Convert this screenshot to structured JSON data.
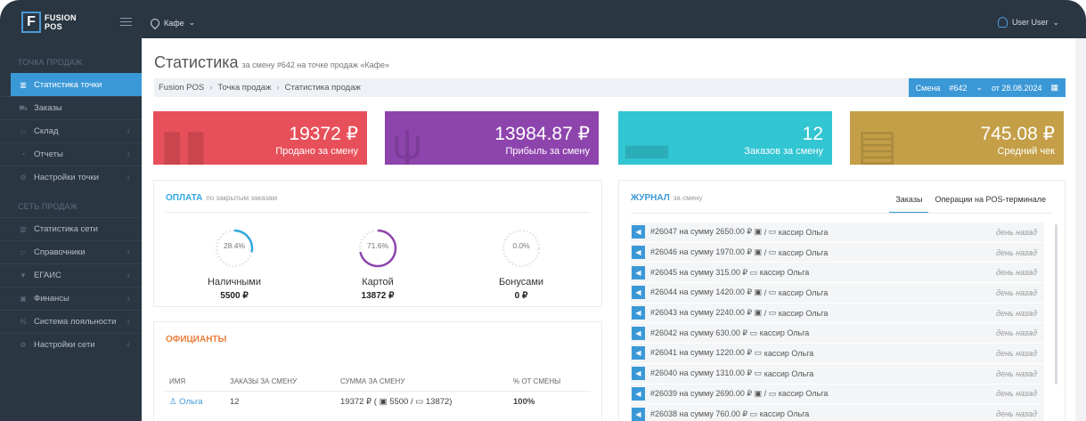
{
  "app": {
    "logo_letter": "F",
    "logo_line1": "FUSION",
    "logo_line2": "POS",
    "location": "Кафе",
    "user": "User User"
  },
  "sidebar": {
    "section1": "ТОЧКА ПРОДАЖ",
    "section2": "СЕТЬ ПРОДАЖ",
    "items1": [
      {
        "label": "Статистика точки",
        "icon": "chart-icon",
        "arrow": ""
      },
      {
        "label": "Заказы",
        "icon": "cart-icon",
        "arrow": ""
      },
      {
        "label": "Склад",
        "icon": "box-icon",
        "arrow": "‹"
      },
      {
        "label": "Отчеты",
        "icon": "pie-icon",
        "arrow": "‹"
      },
      {
        "label": "Настройки точки",
        "icon": "gear-icon",
        "arrow": "‹"
      }
    ],
    "items2": [
      {
        "label": "Статистика сети",
        "icon": "chart-icon",
        "arrow": ""
      },
      {
        "label": "Справочники",
        "icon": "folder-icon",
        "arrow": "‹"
      },
      {
        "label": "ЕГАИС",
        "icon": "filter-icon",
        "arrow": "‹"
      },
      {
        "label": "Финансы",
        "icon": "wallet-icon",
        "arrow": "‹"
      },
      {
        "label": "Система лояльности",
        "icon": "percent-icon",
        "arrow": "‹"
      },
      {
        "label": "Настройки сети",
        "icon": "gear-icon",
        "arrow": "‹"
      }
    ]
  },
  "page": {
    "title": "Статистика",
    "subtitle": "за смену #642 на точке продаж «Кафе»"
  },
  "breadcrumb": [
    "Fusion POS",
    "Точка продаж",
    "Статистика продаж"
  ],
  "shift": {
    "label": "Смена",
    "number": "#642",
    "date": "от 28.08.2024"
  },
  "tiles": [
    {
      "value": "19372 ₽",
      "label": "Продано за смену"
    },
    {
      "value": "13984.87 ₽",
      "label": "Прибыль за смену"
    },
    {
      "value": "12",
      "label": "Заказов за смену"
    },
    {
      "value": "745.08 ₽",
      "label": "Средний чек"
    }
  ],
  "payment": {
    "title": "ОПЛАТА",
    "subtitle": "по закрытым заказам",
    "gauges": [
      {
        "pct": "28.4%",
        "fraction": 0.284,
        "name": "Наличными",
        "amount": "5500 ₽",
        "color": "#32a8e0"
      },
      {
        "pct": "71.6%",
        "fraction": 0.716,
        "name": "Картой",
        "amount": "13872 ₽",
        "color": "#8e44ad"
      },
      {
        "pct": "0.0%",
        "fraction": 0,
        "name": "Бонусами",
        "amount": "0 ₽",
        "color": "#ccc"
      }
    ]
  },
  "waiters": {
    "title": "ОФИЦИАНТЫ",
    "headers": [
      "ИМЯ",
      "ЗАКАЗЫ ЗА СМЕНУ",
      "СУММА ЗА СМЕНУ",
      "% ОТ СМЕНЫ"
    ],
    "rows": [
      {
        "name": "Ольга",
        "orders": "12",
        "sum": "19372 ₽",
        "cash": "5500",
        "card": "13872",
        "percent": "100%"
      }
    ]
  },
  "journal": {
    "title": "ЖУРНАЛ",
    "subtitle": "за смену",
    "tabs": [
      "Заказы",
      "Операции на POS-терминале"
    ],
    "entries": [
      {
        "text": "#26047 на сумму 2650.00 ₽",
        "mixed": true,
        "cashier": "кассир Ольга",
        "time": "день назад"
      },
      {
        "text": "#26046 на сумму 1970.00 ₽",
        "mixed": true,
        "cashier": "кассир Ольга",
        "time": "день назад"
      },
      {
        "text": "#26045 на сумму 315.00 ₽",
        "mixed": false,
        "cashier": "кассир Ольга",
        "time": "день назад"
      },
      {
        "text": "#26044 на сумму 1420.00 ₽",
        "mixed": true,
        "cashier": "кассир Ольга",
        "time": "день назад"
      },
      {
        "text": "#26043 на сумму 2240.00 ₽",
        "mixed": true,
        "cashier": "кассир Ольга",
        "time": "день назад"
      },
      {
        "text": "#26042 на сумму 630.00 ₽",
        "mixed": false,
        "cashier": "кассир Ольга",
        "time": "день назад"
      },
      {
        "text": "#26041 на сумму 1220.00 ₽",
        "mixed": false,
        "cashier": "кассир Ольга",
        "time": "день назад"
      },
      {
        "text": "#26040 на сумму 1310.00 ₽",
        "mixed": false,
        "cashier": "кассир Ольга",
        "time": "день назад"
      },
      {
        "text": "#26039 на сумму 2690.00 ₽",
        "mixed": true,
        "cashier": "кассир Ольга",
        "time": "день назад"
      },
      {
        "text": "#26038 на сумму 760.00 ₽",
        "mixed": false,
        "cashier": "кассир Ольга",
        "time": "день назад"
      }
    ]
  }
}
